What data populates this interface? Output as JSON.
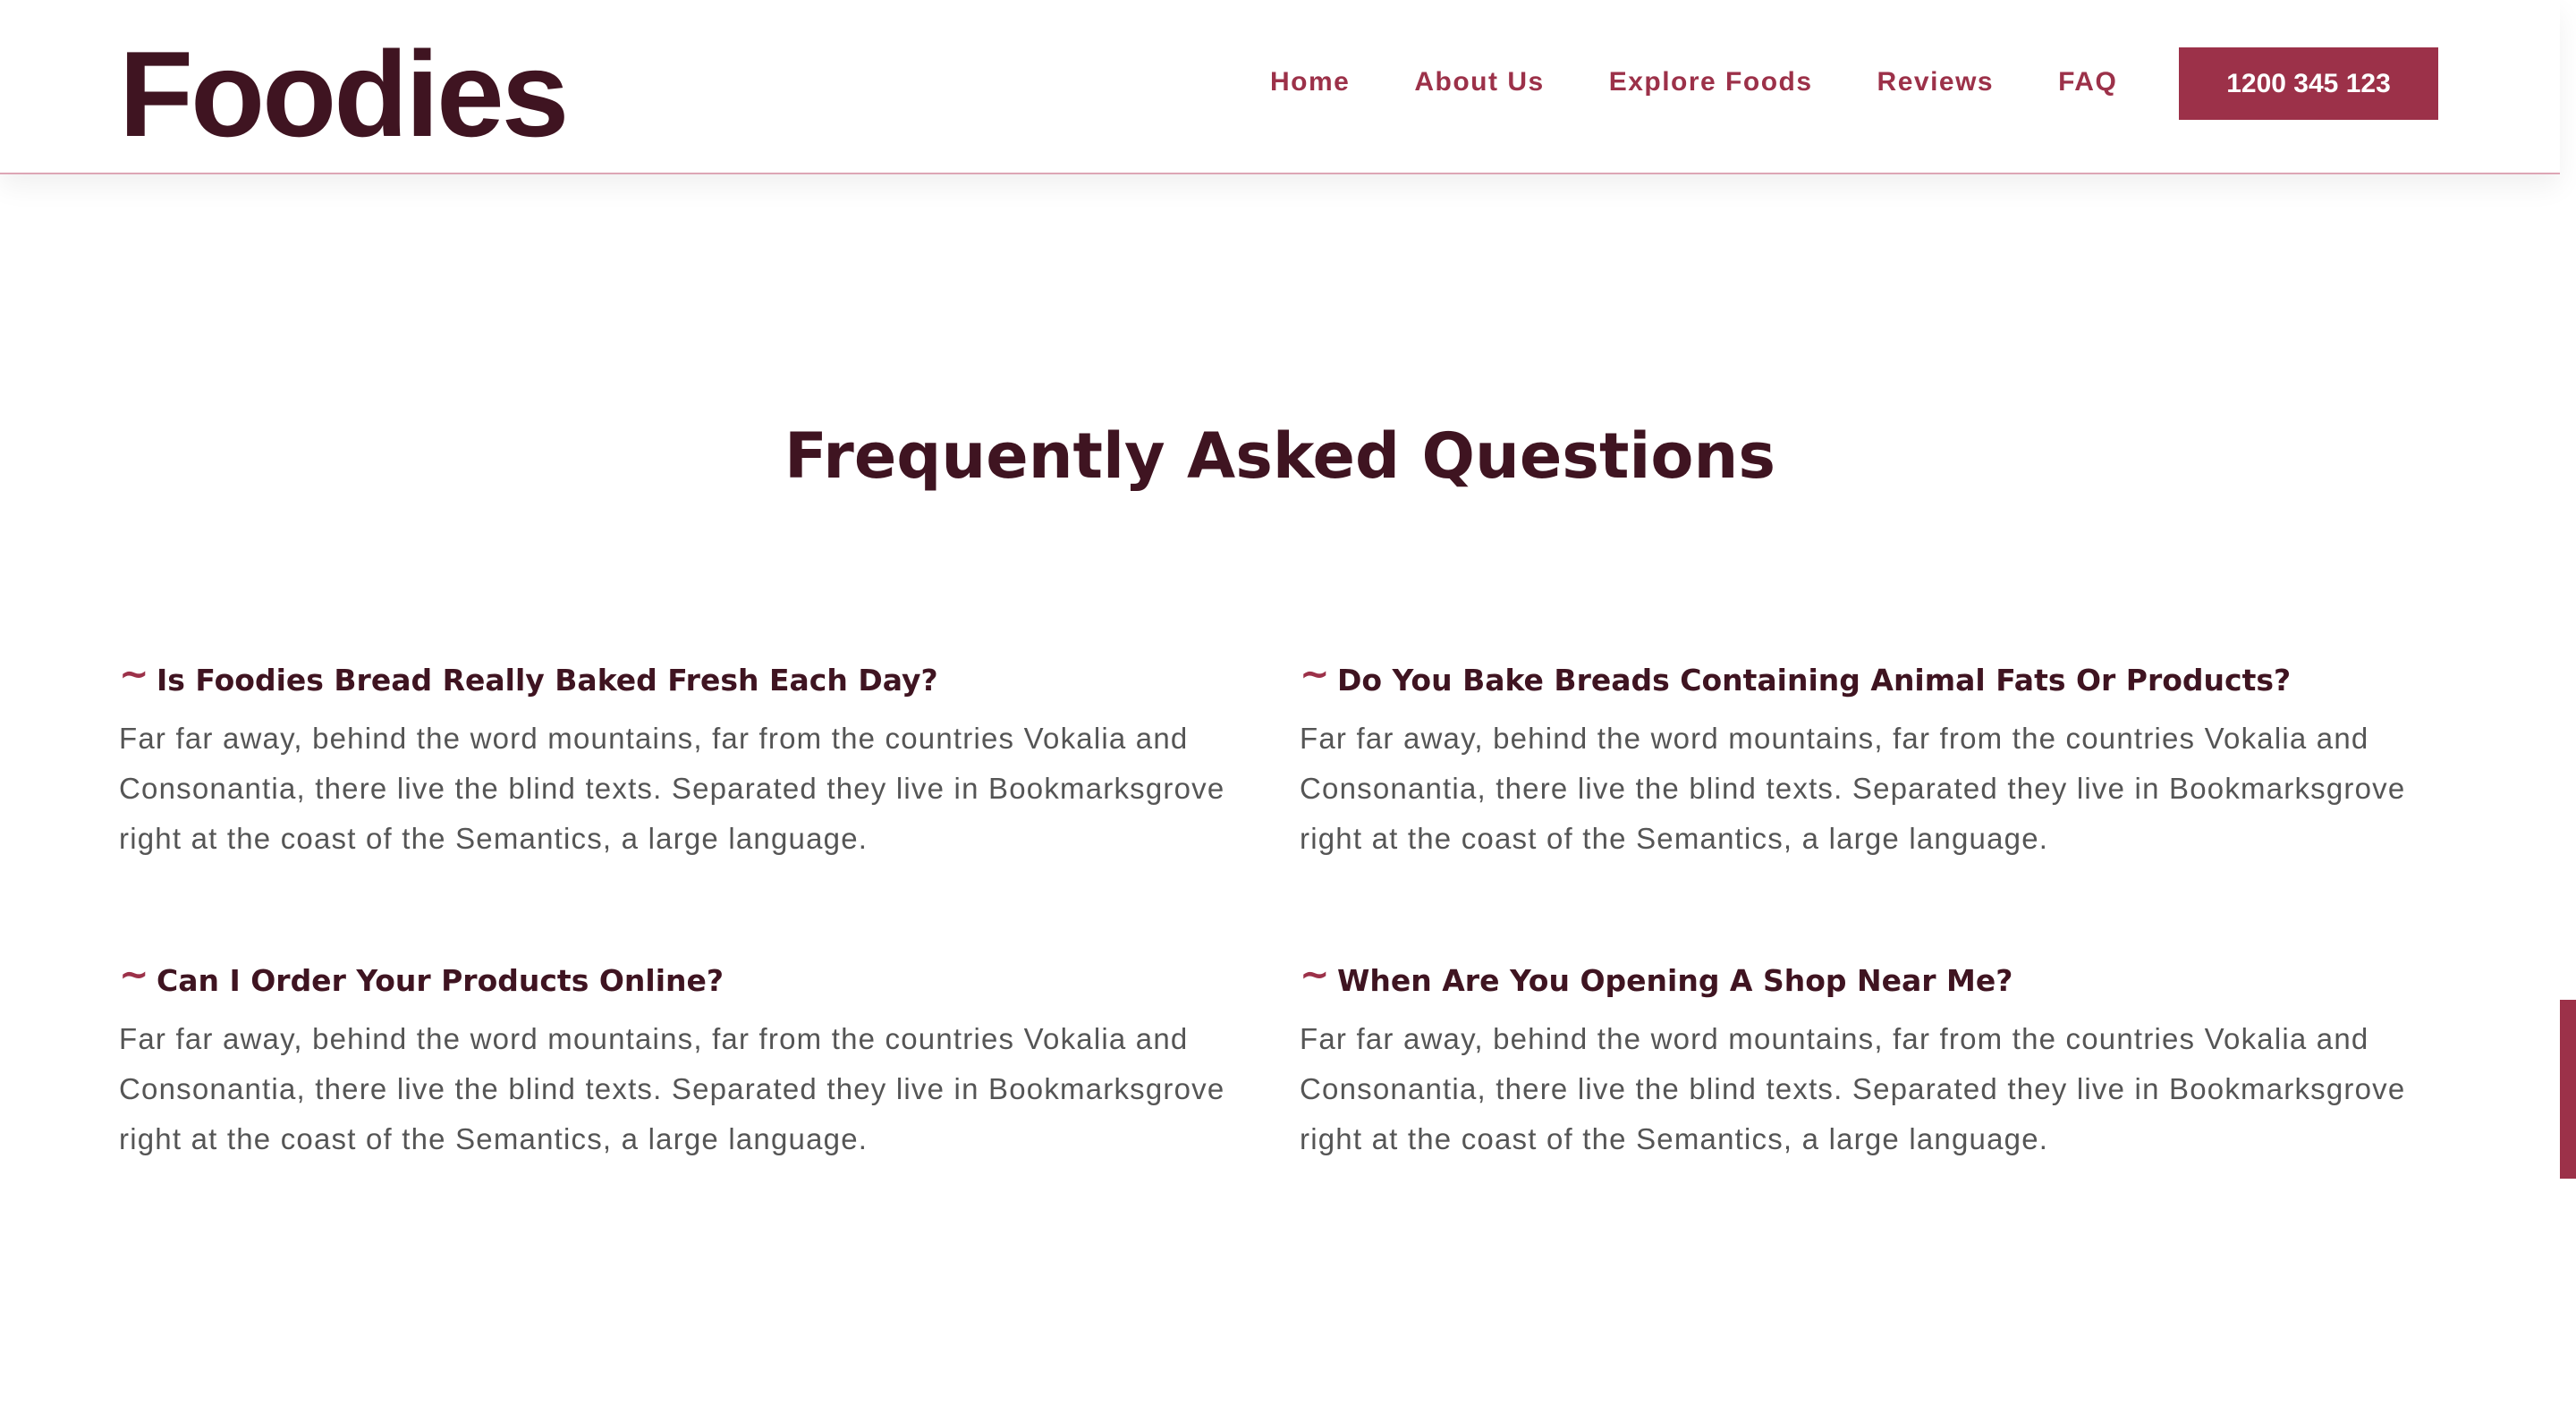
{
  "header": {
    "logo": "Foodies",
    "nav": [
      "Home",
      "About Us",
      "Explore Foods",
      "Reviews",
      "FAQ"
    ],
    "phone": "1200 345 123"
  },
  "faq": {
    "title": "Frequently Asked Questions",
    "items": [
      {
        "question": "Is Foodies Bread Really Baked Fresh Each Day?",
        "answer": "Far far away, behind the word mountains, far from the countries Vokalia and Consonantia, there live the blind texts. Separated they live in Bookmarksgrove right at the coast of the Semantics, a large language."
      },
      {
        "question": "Do You Bake Breads Containing Animal Fats Or Products?",
        "answer": "Far far away, behind the word mountains, far from the countries Vokalia and Consonantia, there live the blind texts. Separated they live in Bookmarksgrove right at the coast of the Semantics, a large language."
      },
      {
        "question": "Can I Order Your Products Online?",
        "answer": "Far far away, behind the word mountains, far from the countries Vokalia and Consonantia, there live the blind texts. Separated they live in Bookmarksgrove right at the coast of the Semantics, a large language."
      },
      {
        "question": "When Are You Opening A Shop Near Me?",
        "answer": "Far far away, behind the word mountains, far from the countries Vokalia and Consonantia, there live the blind texts. Separated they live in Bookmarksgrove right at the coast of the Semantics, a large language."
      }
    ]
  },
  "icons": {
    "question_marker": "tilde-icon"
  },
  "colors": {
    "brand": "#9c3149",
    "heading": "#3f1421",
    "body_text": "#555555",
    "header_border": "#dda6b5"
  }
}
